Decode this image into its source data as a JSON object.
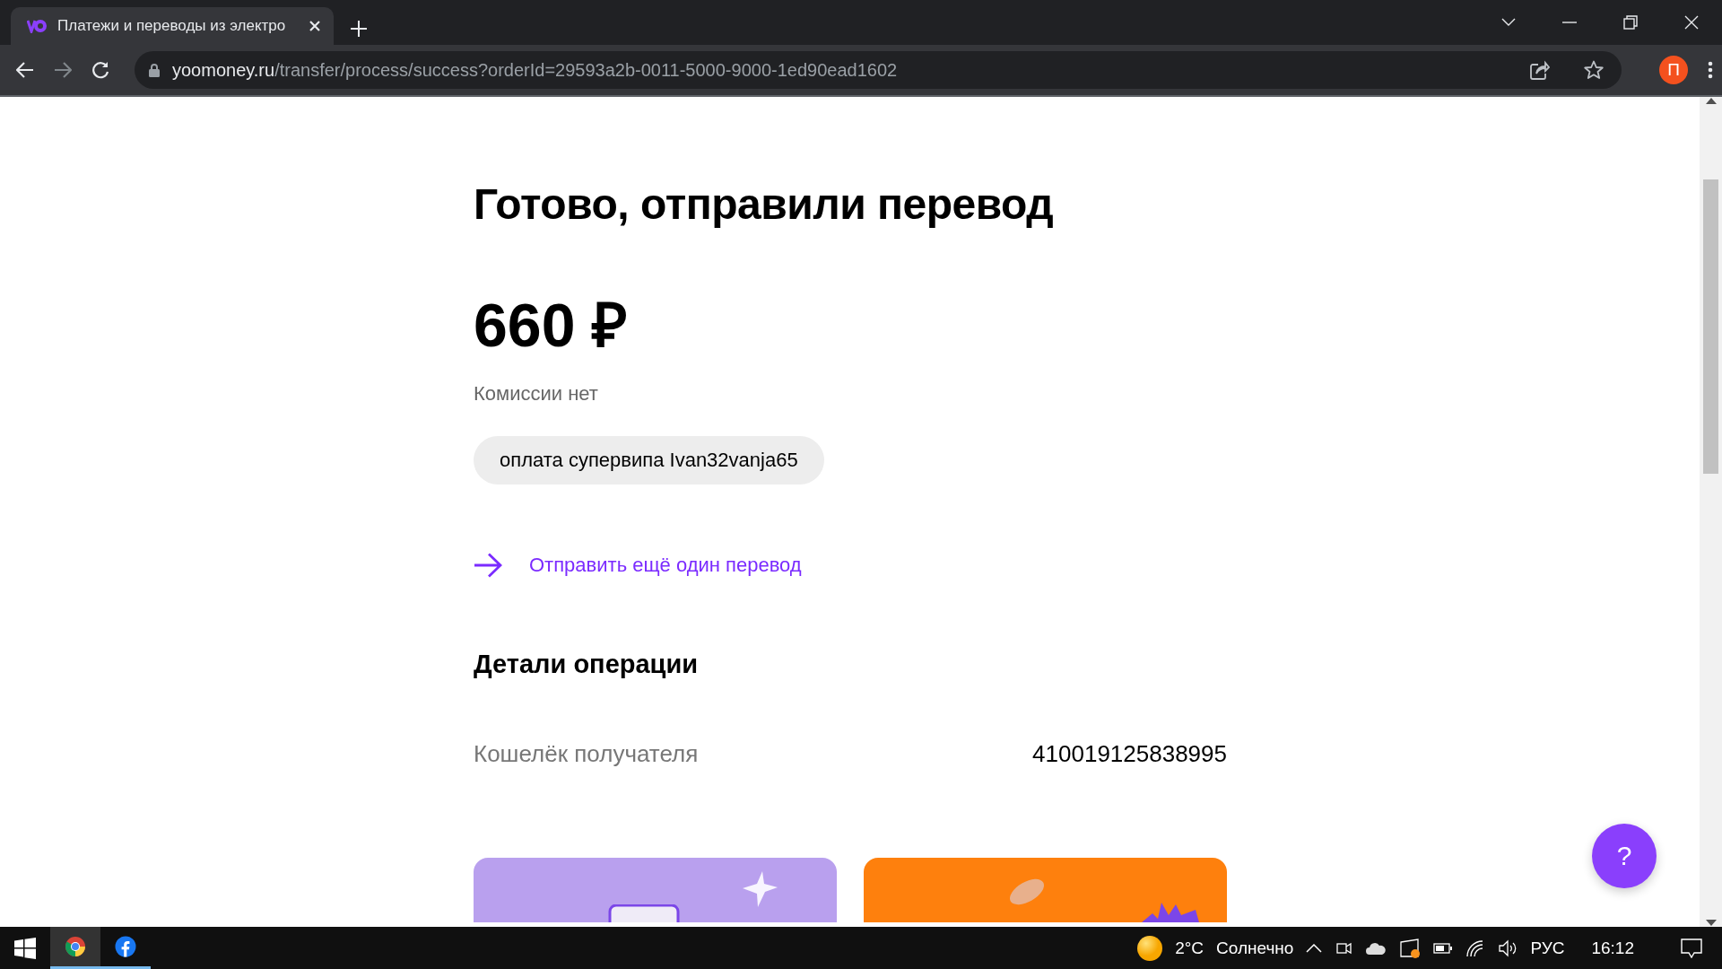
{
  "browser": {
    "tab": {
      "title": "Платежи и переводы из электро",
      "selected": true
    },
    "url": {
      "host": "yoomoney.ru",
      "path": "/transfer/process/success?orderId=29593a2b-0011-5000-9000-1ed90ead1602"
    },
    "profile": {
      "letter": "П"
    }
  },
  "page": {
    "title": "Готово, отправили перевод",
    "amount": "660 ₽",
    "fee": "Комиссии нет",
    "comment": "оплата супервипа Ivan32vanja65",
    "link": "Отправить ещё один перевод",
    "details": {
      "heading": "Детали операции",
      "rows": [
        {
          "label": "Кошелёк получателя",
          "value": "410019125838995"
        }
      ]
    },
    "cards": [
      {
        "color": "#b9a0ee"
      },
      {
        "color": "#fe800d"
      }
    ],
    "help": "?"
  },
  "taskbar": {
    "apps": [
      {
        "kind": "chrome",
        "selected": true
      },
      {
        "kind": "facebook",
        "selected": false
      }
    ],
    "weather": {
      "temp": "2°C",
      "condition": "Солнечно"
    },
    "language": "РУС",
    "time": "16:12"
  }
}
